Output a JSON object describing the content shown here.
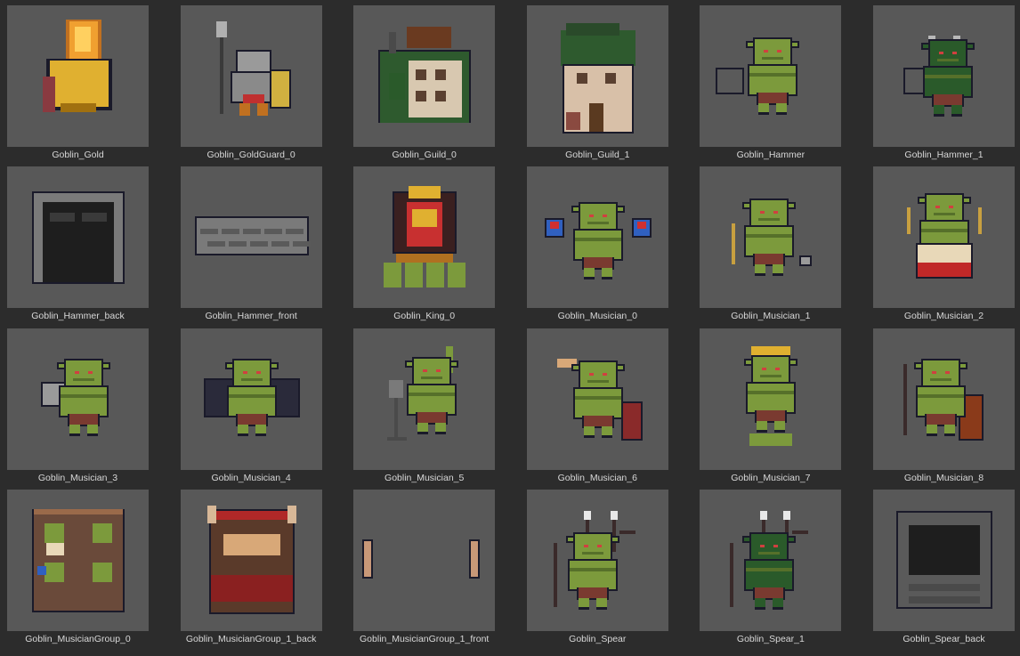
{
  "assets": [
    {
      "name": "Goblin_Gold",
      "art": "gold-goblin-icon"
    },
    {
      "name": "Goblin_GoldGuard_0",
      "art": "armored-guard-icon"
    },
    {
      "name": "Goblin_Guild_0",
      "art": "guild-building-icon"
    },
    {
      "name": "Goblin_Guild_1",
      "art": "guild-tower-icon"
    },
    {
      "name": "Goblin_Hammer",
      "art": "goblin-hammer-icon"
    },
    {
      "name": "Goblin_Hammer_1",
      "art": "goblin-hammer-alt-icon"
    },
    {
      "name": "Goblin_Hammer_back",
      "art": "stone-doorway-icon"
    },
    {
      "name": "Goblin_Hammer_front",
      "art": "stone-wall-icon"
    },
    {
      "name": "Goblin_King_0",
      "art": "goblin-king-throne-icon"
    },
    {
      "name": "Goblin_Musician_0",
      "art": "maracas-goblin-icon"
    },
    {
      "name": "Goblin_Musician_1",
      "art": "triangle-goblin-icon"
    },
    {
      "name": "Goblin_Musician_2",
      "art": "drummer-goblin-icon"
    },
    {
      "name": "Goblin_Musician_3",
      "art": "horn-goblin-icon"
    },
    {
      "name": "Goblin_Musician_4",
      "art": "accordion-goblin-icon"
    },
    {
      "name": "Goblin_Musician_5",
      "art": "microphone-goblin-icon"
    },
    {
      "name": "Goblin_Musician_6",
      "art": "guitar-goblin-icon"
    },
    {
      "name": "Goblin_Musician_7",
      "art": "headband-goblin-icon"
    },
    {
      "name": "Goblin_Musician_8",
      "art": "violin-goblin-icon"
    },
    {
      "name": "Goblin_MusicianGroup_0",
      "art": "band-stage-icon"
    },
    {
      "name": "Goblin_MusicianGroup_1_back",
      "art": "stage-backdrop-icon"
    },
    {
      "name": "Goblin_MusicianGroup_1_front",
      "art": "stage-horns-icon"
    },
    {
      "name": "Goblin_Spear",
      "art": "spear-goblin-icon"
    },
    {
      "name": "Goblin_Spear_1",
      "art": "spear-goblin-alt-icon"
    },
    {
      "name": "Goblin_Spear_back",
      "art": "stone-doorway-dark-icon"
    }
  ],
  "palette": {
    "tile_bg": "#585858",
    "page_bg": "#2c2c2c",
    "goblin_green": "#7c9a3c",
    "goblin_dark": "#56702a",
    "outline": "#1a1a2a",
    "pants": "#7a3a30",
    "gold": "#e0b030",
    "stone": "#8a8a8a"
  },
  "status_text": ""
}
